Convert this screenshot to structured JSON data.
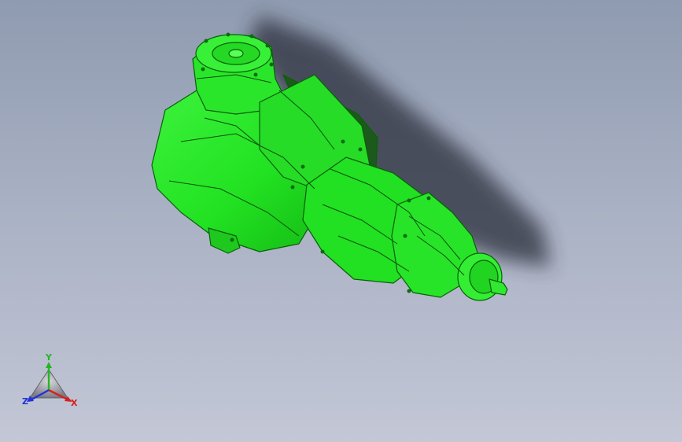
{
  "triad": {
    "x_label": "X",
    "y_label": "Y",
    "z_label": "Z",
    "x_color": "#d62020",
    "y_color": "#22b822",
    "z_color": "#2233d8"
  },
  "model": {
    "icon": "gearbox-model",
    "body_color": "#22e622",
    "edge_color": "#0b5e0b"
  },
  "viewport": {
    "background_top": "#8f9bb0",
    "background_bottom": "#c3c7d6"
  }
}
